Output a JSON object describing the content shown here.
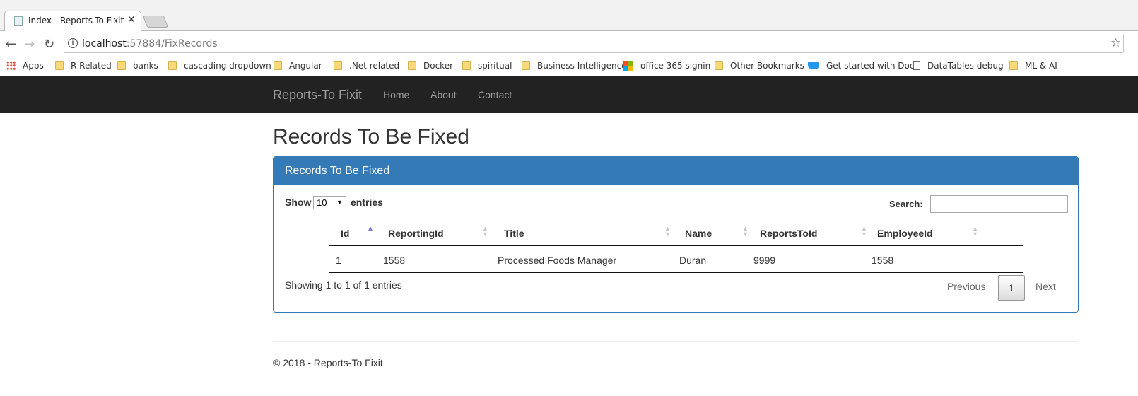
{
  "browser": {
    "tab_title": "Index - Reports-To Fixit",
    "tab_close": "✕",
    "url_host": "localhost",
    "url_path": ":57884/FixRecords",
    "bookmarks": [
      "Apps",
      "R Related",
      "banks",
      "cascading dropdown",
      "Angular",
      ".Net related",
      "Docker",
      "spiritual",
      "Business Intelligence",
      "office 365 signin",
      "Other Bookmarks",
      "Get started with Doc",
      "DataTables debug",
      "ML & AI"
    ]
  },
  "navbar": {
    "brand": "Reports-To Fixit",
    "links": [
      "Home",
      "About",
      "Contact"
    ]
  },
  "page": {
    "title": "Records To Be Fixed"
  },
  "panel": {
    "title": "Records To Be Fixed",
    "show_label": "Show",
    "length_value": "10",
    "entries_label": "entries",
    "search_label": "Search:",
    "search_value": "",
    "columns": [
      "Id",
      "ReportingId",
      "Title",
      "Name",
      "ReportsToId",
      "EmployeeId"
    ],
    "rows": [
      [
        "1",
        "1558",
        "Processed Foods Manager",
        "Duran",
        "9999",
        "1558"
      ]
    ],
    "info": "Showing 1 to 1 of 1 entries",
    "pagination": {
      "previous": "Previous",
      "current": "1",
      "next": "Next"
    }
  },
  "footer": {
    "text": "© 2018 - Reports-To Fixit"
  },
  "colors": {
    "navbar_bg": "#222222",
    "panel_primary": "#337ab7",
    "sort_active": "#7a79d4"
  }
}
